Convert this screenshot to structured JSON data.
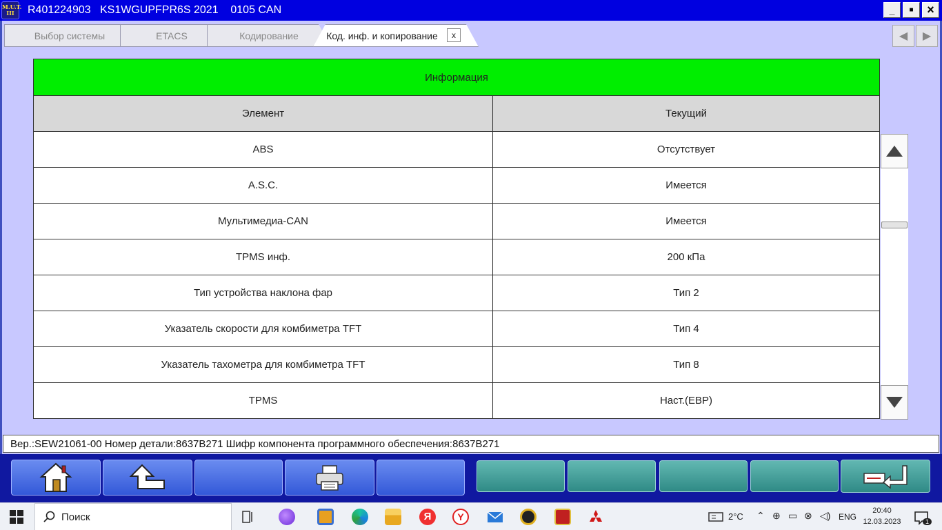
{
  "window": {
    "logo_text": "M.U.T.\nIII",
    "title": "R401224903   KS1WGUPFPR6S 2021    0105 CAN",
    "min_glyph": "_",
    "max_glyph": "■",
    "close_glyph": "×"
  },
  "tabs": [
    {
      "label": "Выбор системы"
    },
    {
      "label": "ETACS"
    },
    {
      "label": "Кодирование"
    },
    {
      "label": "Код. инф. и копирование"
    }
  ],
  "tab_close": "x",
  "nav": {
    "prev": "◀",
    "next": "▶"
  },
  "table": {
    "header": "Информация",
    "col1": "Элемент",
    "col2": "Текущий",
    "rows": [
      {
        "item": "ABS",
        "value": "Отсутствует"
      },
      {
        "item": "A.S.C.",
        "value": "Имеется"
      },
      {
        "item": "Мультимедиа-CAN",
        "value": "Имеется"
      },
      {
        "item": "TPMS инф.",
        "value": "200 кПа"
      },
      {
        "item": "Тип устройства наклона фар",
        "value": "Тип 2"
      },
      {
        "item": "Указатель скорости для комбиметра TFT",
        "value": "Тип 4"
      },
      {
        "item": "Указатель тахометра для комбиметра TFT",
        "value": "Тип 8"
      },
      {
        "item": "TPMS",
        "value": "Наст.(EBP)"
      }
    ]
  },
  "status": "Вер.:SEW21061-00 Номер детали:8637B271   Шифр компонента программного обеспечения:8637B271",
  "taskbar": {
    "search_label": "Поиск",
    "temperature": "2°C",
    "language": "ENG",
    "time": "20:40",
    "date": "12.03.2023",
    "notifications": "1"
  },
  "colors": {
    "titlebar": "#0000e0",
    "header_green": "#00ee00",
    "frame": "#c8c8ff",
    "toolbar": "#1018a0"
  }
}
